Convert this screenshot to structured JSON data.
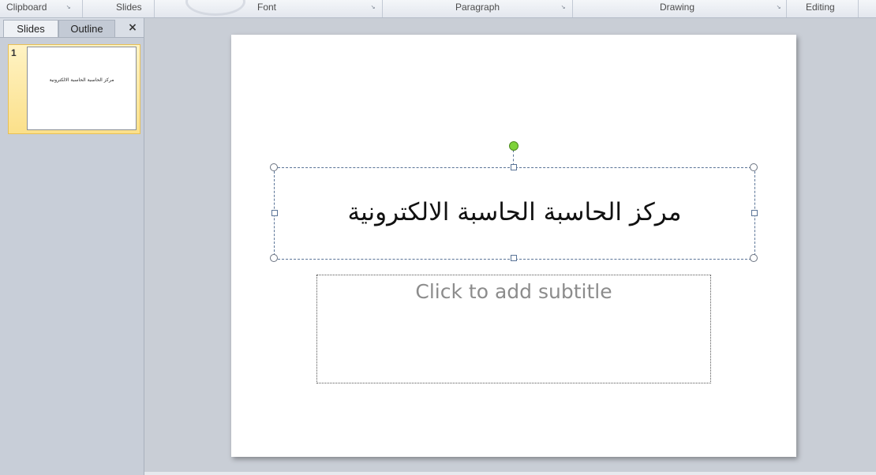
{
  "ribbon": {
    "groups": [
      {
        "label": "Clipboard",
        "launcher": true
      },
      {
        "label": "Slides",
        "launcher": false
      },
      {
        "label": "Font",
        "launcher": true
      },
      {
        "label": "Paragraph",
        "launcher": true
      },
      {
        "label": "Drawing",
        "launcher": true
      },
      {
        "label": "Editing",
        "launcher": false
      }
    ],
    "launcher_glyph": "↘"
  },
  "panel": {
    "tabs": [
      {
        "label": "Slides",
        "active": true
      },
      {
        "label": "Outline",
        "active": false
      }
    ],
    "close_glyph": "×",
    "thumbnails": [
      {
        "number": "1",
        "title": "مركز الحاسبة الحاسبة الالكترونية"
      }
    ]
  },
  "slide": {
    "title": "مركز الحاسبة الحاسبة الالكترونية",
    "subtitle_placeholder": "Click to add subtitle"
  },
  "colors": {
    "selection_accent": "#5a7497",
    "rotate_handle": "#7ed23a",
    "thumbnail_highlight": "#fbe08a"
  },
  "icons": {
    "dialog_launcher": "dialog-launcher-icon",
    "close": "close-icon",
    "rotate": "rotate-handle-icon"
  }
}
